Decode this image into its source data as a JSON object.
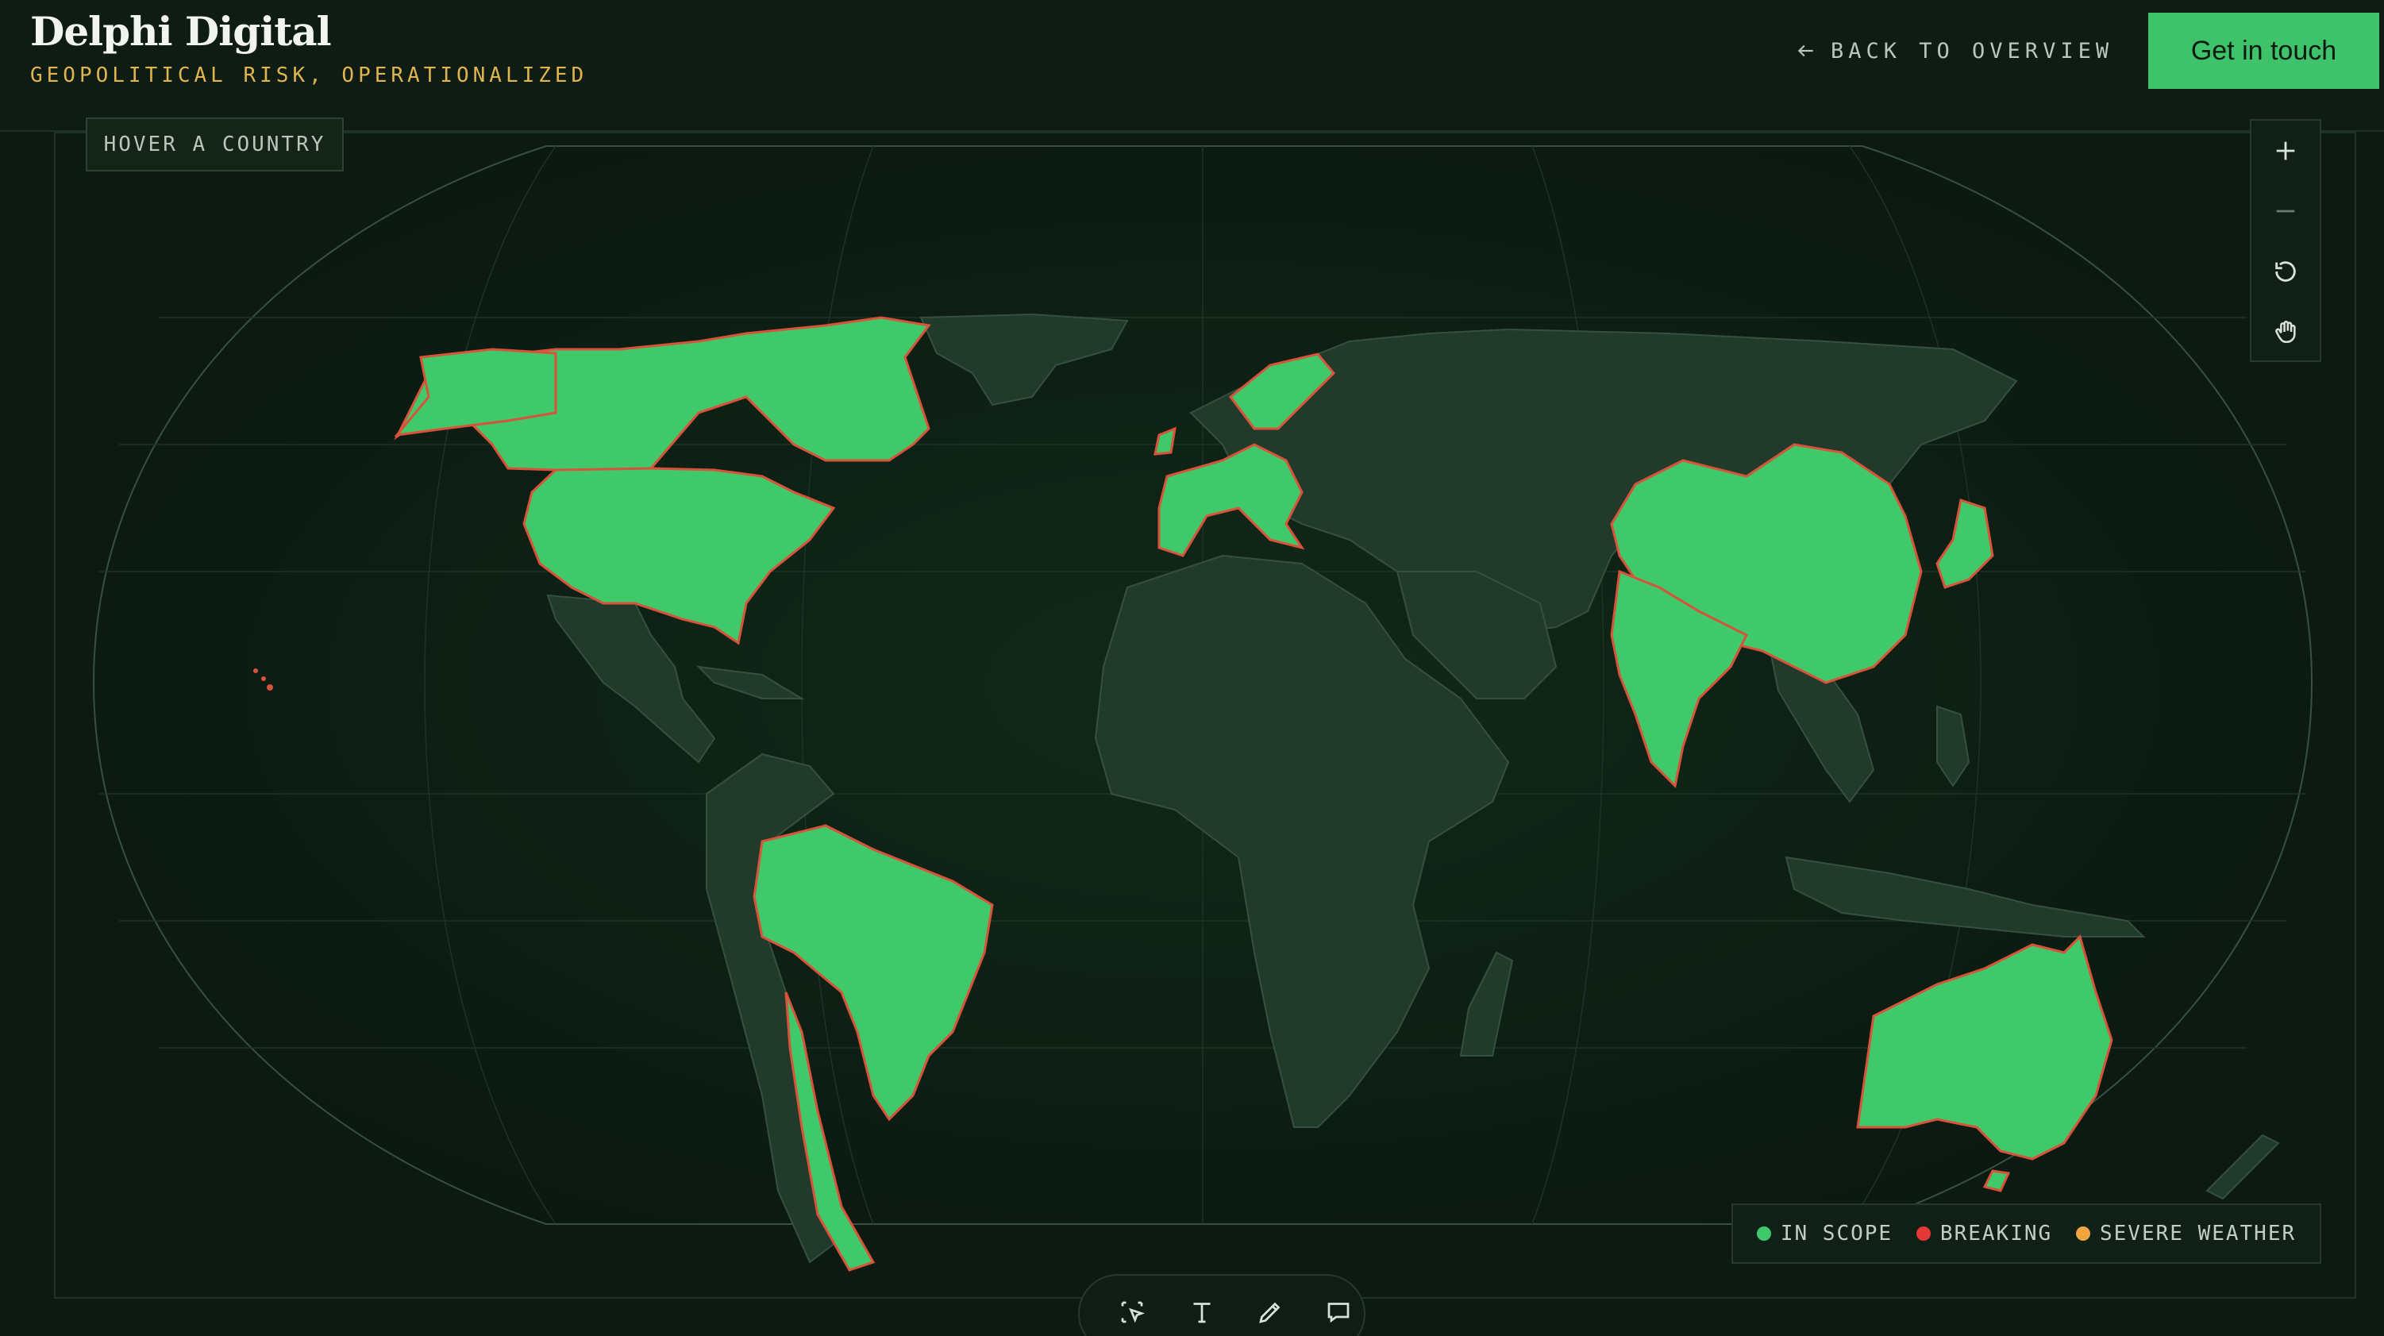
{
  "header": {
    "brand": "Delphi Digital",
    "tagline": "GEOPOLITICAL RISK, OPERATIONALIZED",
    "back_label": "BACK TO OVERVIEW",
    "cta_label": "Get in touch"
  },
  "map": {
    "hover_hint": "HOVER A COUNTRY",
    "highlighted_regions": [
      "United States",
      "Canada",
      "Brazil",
      "Western Europe",
      "Scandinavia",
      "China",
      "India",
      "Japan",
      "Australia",
      "Chile"
    ],
    "zoom_controls": [
      "zoom-in",
      "zoom-out",
      "reset",
      "pan"
    ]
  },
  "legend": {
    "items": [
      {
        "label": "IN SCOPE",
        "color": "#3fc96a"
      },
      {
        "label": "BREAKING",
        "color": "#e53935"
      },
      {
        "label": "SEVERE WEATHER",
        "color": "#f0a640"
      }
    ]
  },
  "colors": {
    "accent": "#3ec36b",
    "land": "#223a2b",
    "in_scope": "#3fc96a",
    "breaking_border": "#d9533a",
    "tagline": "#e0b44e"
  },
  "toolbar": {
    "tools": [
      "select-icon",
      "text-icon",
      "pen-icon",
      "comment-icon"
    ]
  }
}
